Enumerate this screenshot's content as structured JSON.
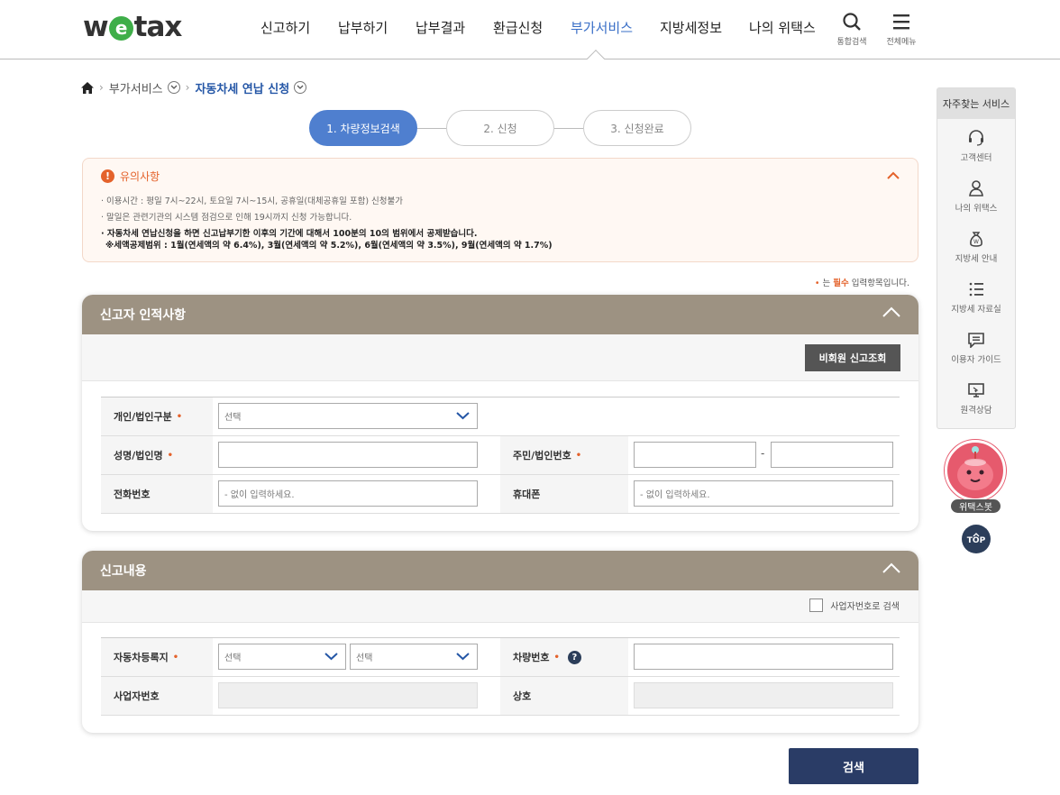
{
  "header": {
    "logo": {
      "pre": "w",
      "mid": "e",
      "post": "tax"
    },
    "nav": [
      {
        "label": "신고하기"
      },
      {
        "label": "납부하기"
      },
      {
        "label": "납부결과"
      },
      {
        "label": "환급신청"
      },
      {
        "label": "부가서비스",
        "active": true
      },
      {
        "label": "지방세정보"
      },
      {
        "label": "나의 위택스"
      }
    ],
    "search_label": "통합검색",
    "menu_label": "전체메뉴",
    "active_color": "#3a6fc7"
  },
  "breadcrumb": {
    "items": [
      "부가서비스",
      "자동차세 연납 신청"
    ]
  },
  "steps": [
    "1. 차량정보검색",
    "2. 신청",
    "3. 신청완료"
  ],
  "notice": {
    "title": "유의사항",
    "lines": [
      "· 이용시간 : 평일 7시~22시, 토요일 7시~15시, 공휴일(대체공휴일 포함) 신청불가",
      "· 말일은 관련기관의 시스템 점검으로 인해 19시까지 신청 가능합니다.",
      "· 자동차세 연납신청을 하면 신고납부기한 이후의 기간에 대해서 100분의 10의 범위에서 공제받습니다.",
      "  ※세액공제범위 : 1월(연세액의 약 6.4%), 3월(연세액의 약 5.2%), 6월(연세액의 약 3.5%), 9월(연세액의 약 1.7%)"
    ]
  },
  "required_note": {
    "bullet": "•",
    "pre": " 는 ",
    "word": "필수",
    "post": " 입력항목입니다."
  },
  "section1": {
    "title": "신고자 인적사항",
    "button": "비회원 신고조회",
    "fields": {
      "type_label": "개인/법인구분",
      "type_value": "선택",
      "name_label": "성명/법인명",
      "id_label": "주민/법인번호",
      "id_sep": "-",
      "phone_label": "전화번호",
      "phone_placeholder": "- 없이 입력하세요.",
      "mobile_label": "휴대폰",
      "mobile_placeholder": "- 없이 입력하세요."
    }
  },
  "section2": {
    "title": "신고내용",
    "checkbox_label": "사업자번호로 검색",
    "fields": {
      "reg_label": "자동차등록지",
      "reg_sel1": "선택",
      "reg_sel2": "선택",
      "car_label": "차량번호",
      "help": "?",
      "biz_label": "사업자번호",
      "company_label": "상호"
    }
  },
  "search_button": "검색",
  "sidebar": {
    "title": "자주찾는 서비스",
    "items": [
      {
        "label": "고객센터",
        "icon": "headset-icon"
      },
      {
        "label": "나의 위택스",
        "icon": "person-icon"
      },
      {
        "label": "지방세 안내",
        "icon": "money-bag-icon"
      },
      {
        "label": "지방세 자료실",
        "icon": "list-icon"
      },
      {
        "label": "이용자 가이드",
        "icon": "chat-icon"
      },
      {
        "label": "원격상담",
        "icon": "monitor-icon"
      }
    ],
    "bot_label": "위택스봇",
    "top_label": "TOP"
  }
}
